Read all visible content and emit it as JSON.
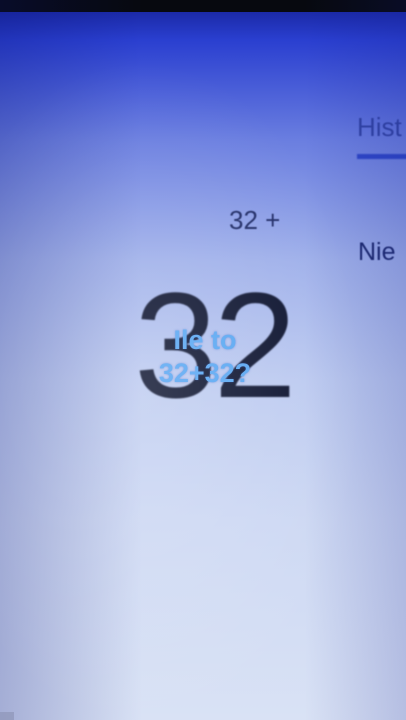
{
  "calculator": {
    "expression": "32 +",
    "display": "32"
  },
  "history_panel": {
    "tab_label": "Hist",
    "empty_text": "Nie"
  },
  "overlay": {
    "line1": "Ile to",
    "line2": "32+32?"
  }
}
